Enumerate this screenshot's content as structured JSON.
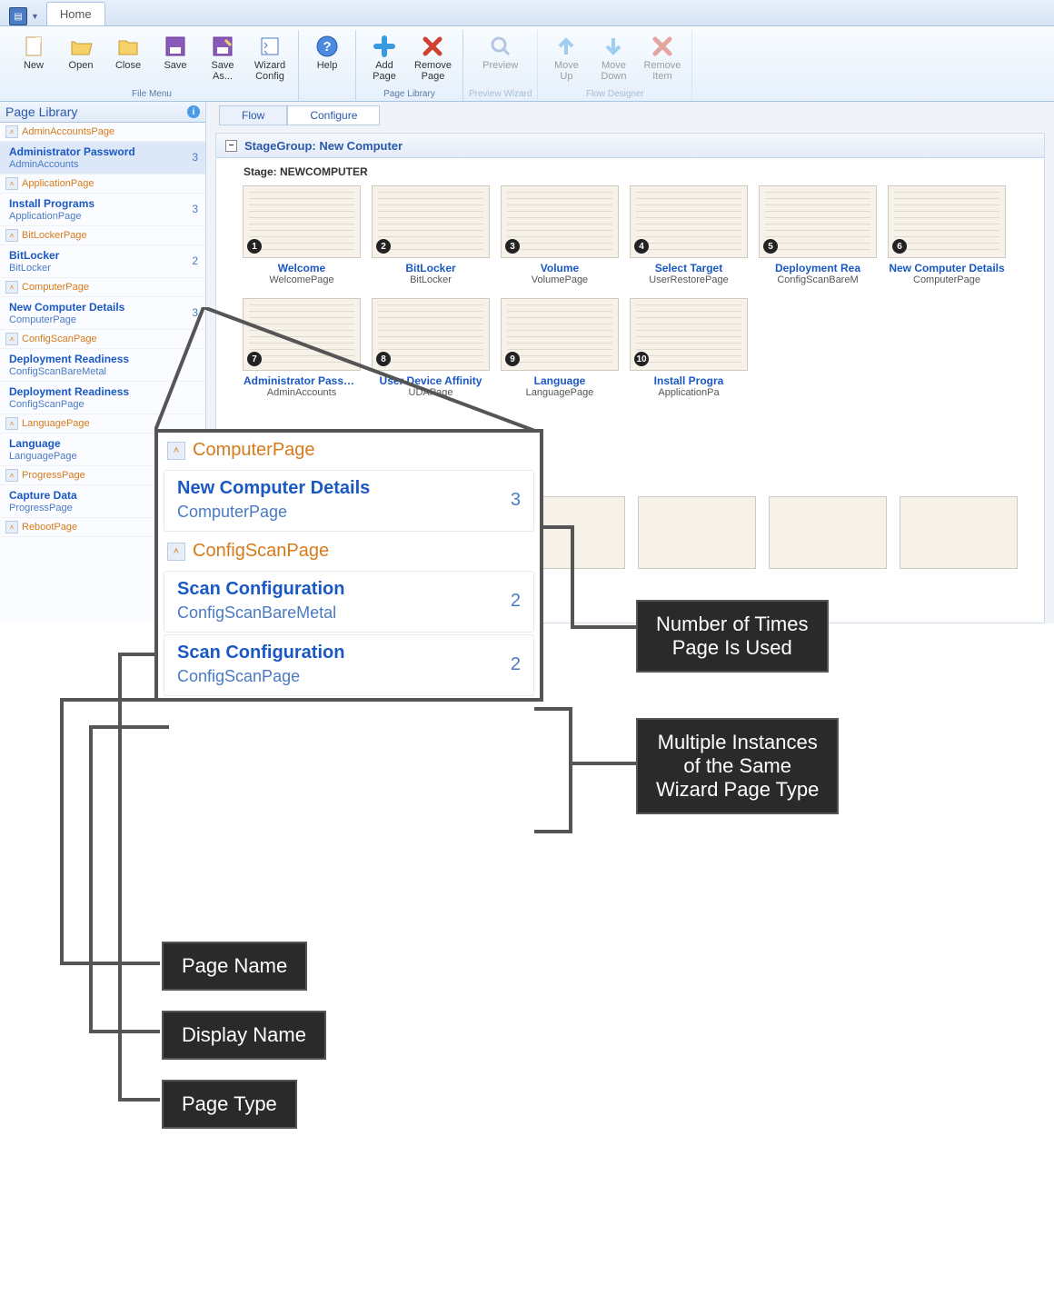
{
  "ribbon": {
    "tab": "Home",
    "groups": {
      "file": {
        "label": "File Menu",
        "btns": [
          "New",
          "Open",
          "Close",
          "Save",
          "Save\nAs...",
          "Wizard\nConfig"
        ]
      },
      "help": {
        "btns": [
          "Help"
        ]
      },
      "pagelib": {
        "label": "Page Library",
        "btns": [
          "Add\nPage",
          "Remove\nPage"
        ]
      },
      "preview": {
        "label": "Preview Wizard",
        "btns": [
          "Preview"
        ]
      },
      "flow": {
        "label": "Flow Designer",
        "btns": [
          "Move\nUp",
          "Move\nDown",
          "Remove\nItem"
        ]
      }
    }
  },
  "sidebar": {
    "title": "Page Library",
    "groups": [
      {
        "name": "AdminAccountsPage",
        "items": [
          {
            "nm": "Administrator Password",
            "sub": "AdminAccounts",
            "cnt": "3",
            "sel": true
          }
        ]
      },
      {
        "name": "ApplicationPage",
        "items": [
          {
            "nm": "Install Programs",
            "sub": "ApplicationPage",
            "cnt": "3"
          }
        ]
      },
      {
        "name": "BitLockerPage",
        "items": [
          {
            "nm": "BitLocker",
            "sub": "BitLocker",
            "cnt": "2"
          }
        ]
      },
      {
        "name": "ComputerPage",
        "items": [
          {
            "nm": "New Computer Details",
            "sub": "ComputerPage",
            "cnt": "3"
          }
        ]
      },
      {
        "name": "ConfigScanPage",
        "items": [
          {
            "nm": "Deployment Readiness",
            "sub": "ConfigScanBareMetal",
            "cnt": ""
          },
          {
            "nm": "Deployment Readiness",
            "sub": "ConfigScanPage",
            "cnt": ""
          }
        ]
      },
      {
        "name": "LanguagePage",
        "items": [
          {
            "nm": "Language",
            "sub": "LanguagePage",
            "cnt": ""
          }
        ]
      },
      {
        "name": "ProgressPage",
        "items": [
          {
            "nm": "Capture Data",
            "sub": "ProgressPage",
            "cnt": ""
          }
        ]
      },
      {
        "name": "RebootPage",
        "items": []
      }
    ]
  },
  "main": {
    "tabs": [
      "Flow",
      "Configure"
    ],
    "stagegroup": "StageGroup: New Computer",
    "stage": "Stage: NEWCOMPUTER",
    "thumbs": [
      {
        "n": "1",
        "t": "Welcome",
        "s": "WelcomePage"
      },
      {
        "n": "2",
        "t": "BitLocker",
        "s": "BitLocker"
      },
      {
        "n": "3",
        "t": "Volume",
        "s": "VolumePage"
      },
      {
        "n": "4",
        "t": "Select Target",
        "s": "UserRestorePage"
      },
      {
        "n": "5",
        "t": "Deployment Rea",
        "s": "ConfigScanBareM"
      },
      {
        "n": "6",
        "t": "New Computer Details",
        "s": "ComputerPage"
      },
      {
        "n": "7",
        "t": "Administrator Passw...",
        "s": "AdminAccounts"
      },
      {
        "n": "8",
        "t": "User Device Affinity",
        "s": "UDAPage"
      },
      {
        "n": "9",
        "t": "Language",
        "s": "LanguagePage"
      },
      {
        "n": "10",
        "t": "Install Progra",
        "s": "ApplicationPa"
      }
    ]
  },
  "zoom": {
    "g1": "ComputerPage",
    "i1": {
      "nm": "New Computer Details",
      "sub": "ComputerPage",
      "cnt": "3"
    },
    "g2": "ConfigScanPage",
    "i2": {
      "nm": "Scan Configuration",
      "sub": "ConfigScanBareMetal",
      "cnt": "2"
    },
    "i3": {
      "nm": "Scan Configuration",
      "sub": "ConfigScanPage",
      "cnt": "2"
    }
  },
  "callouts": {
    "c1": "Number of Times\nPage Is Used",
    "c2": "Multiple Instances\nof the Same\nWizard Page Type",
    "c3": "Page Name",
    "c4": "Display Name",
    "c5": "Page Type"
  }
}
